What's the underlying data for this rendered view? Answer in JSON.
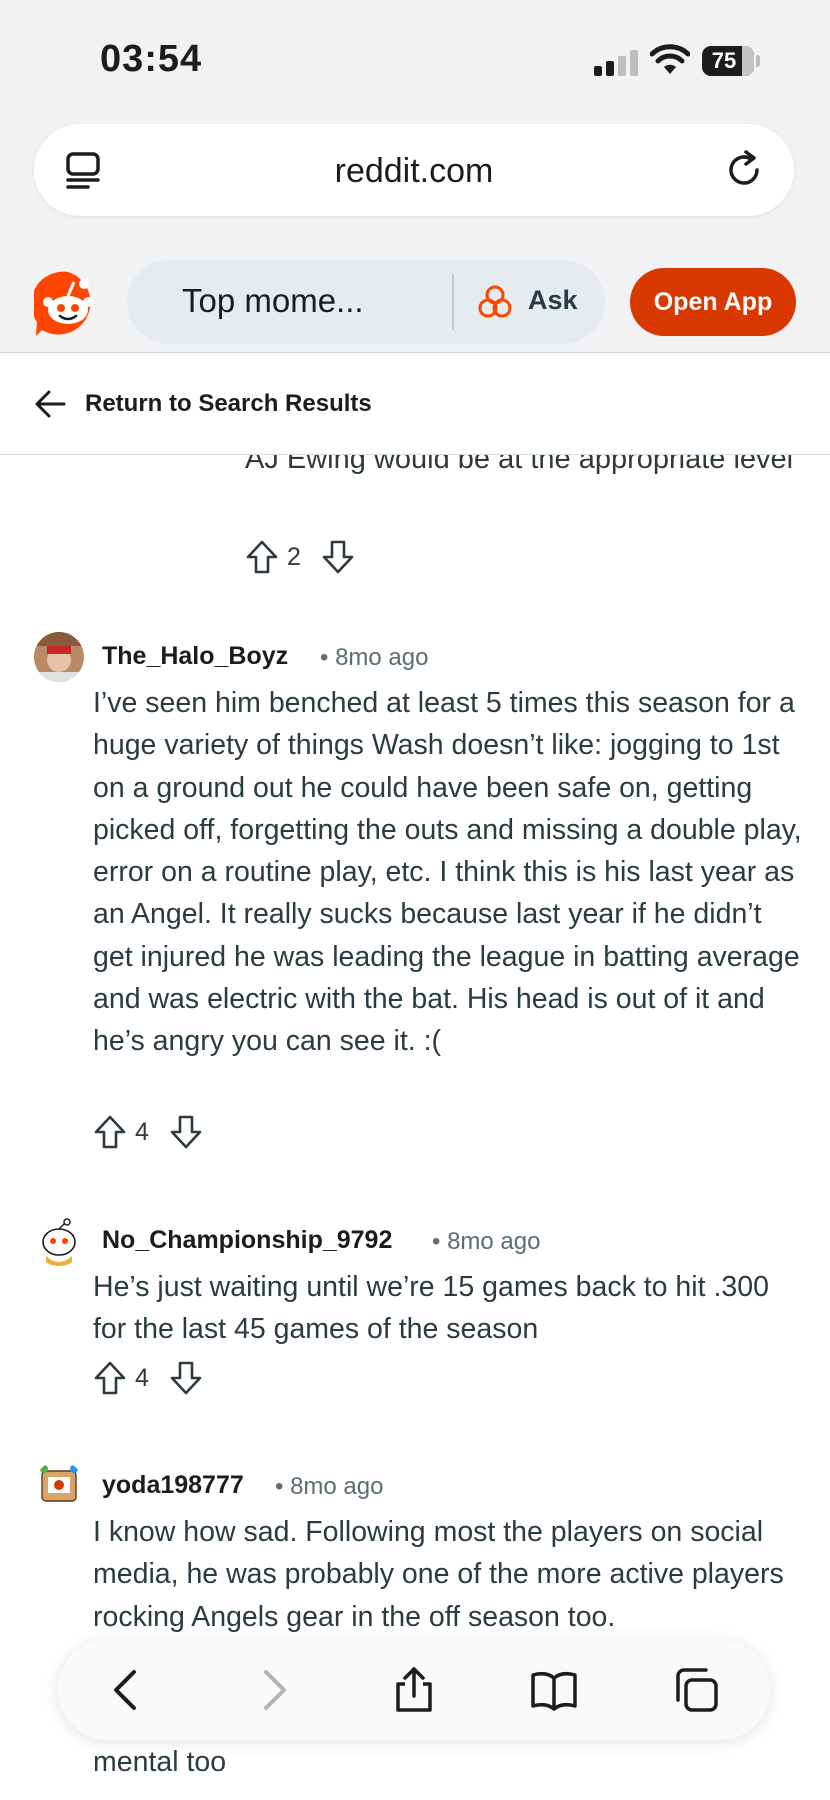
{
  "status_bar": {
    "time": "03:54",
    "battery": "75"
  },
  "browser": {
    "url": "reddit.com"
  },
  "header": {
    "search_text": "Top mome...",
    "ask_label": "Ask",
    "open_app_label": "Open App"
  },
  "nav": {
    "return_label": "Return to Search Results"
  },
  "previous_comment": {
    "text": "AJ Ewing would be at the appropriate level",
    "votes": "2"
  },
  "comments": [
    {
      "author": "The_Halo_Boyz",
      "age": "• 8mo ago",
      "text": "I’ve seen him benched at least 5 times this season for a huge variety of things Wash doesn’t like: jogging to 1st on a ground out he could have been safe on, getting picked off, forgetting the outs and missing a double play, error on a routine play, etc. I think this is his last year as an Angel. It really sucks because last year if he didn’t get injured he was leading the league in batting average and was electric with the bat. His head is out of it and he’s angry you can see it. :(",
      "votes": "4"
    },
    {
      "author": "No_Championship_9792",
      "age": "• 8mo ago",
      "text": "He’s just waiting until we’re 15 games back to hit .300 for the last 45 games of the season",
      "votes": "4"
    },
    {
      "author": "yoda198777",
      "age": "• 8mo ago",
      "text": "I know how sad. Following most the players on social media, he was probably one of the more active players rocking Angels gear in the off season too.",
      "tail": "mental too"
    }
  ],
  "toolbar": {
    "icons": [
      "back-icon",
      "forward-icon",
      "share-icon",
      "bookmarks-icon",
      "tabs-icon"
    ]
  },
  "colors": {
    "accent": "#d93900",
    "background": "#f2f2f4",
    "text": "#2a3c42"
  }
}
